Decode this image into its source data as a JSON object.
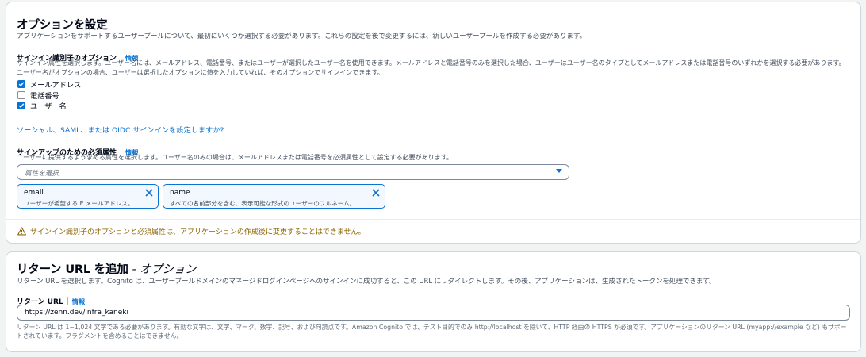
{
  "options_section": {
    "title": "オプションを設定",
    "description": "アプリケーションをサポートするユーザープールについて、最初にいくつか選択する必要があります。これらの設定を後で変更するには、新しいユーザープールを作成する必要があります。",
    "signin": {
      "label": "サインイン識別子のオプション",
      "info": "情報",
      "description_line1": "サインイン属性を選択します。ユーザー名には、メールアドレス、電話番号、またはユーザーが選択したユーザー名を使用できます。メールアドレスと電話番号のみを選択した場合、ユーザーはユーザー名のタイプとしてメールアドレスまたは電話番号のいずれかを選択する必要があります。",
      "description_line2": "ユーザー名がオプションの場合、ユーザーは選択したオプションに値を入力していれば、そのオプションでサインインできます。",
      "checkboxes": [
        {
          "label": "メールアドレス",
          "checked": true
        },
        {
          "label": "電話番号",
          "checked": false
        },
        {
          "label": "ユーザー名",
          "checked": true
        }
      ],
      "social_link": "ソーシャル、SAML、または OIDC サインインを設定しますか?"
    },
    "signup": {
      "label": "サインアップのための必須属性",
      "info": "情報",
      "description": "ユーザーに提供するよう求める属性を選択します。ユーザー名のみの場合は、メールアドレスまたは電話番号を必須属性として設定する必要があります。",
      "select_placeholder": "属性を選択",
      "tokens": [
        {
          "name": "email",
          "description": "ユーザーが希望する E メールアドレス。"
        },
        {
          "name": "name",
          "description": "すべての名前部分を含む、表示可能な形式のユーザーのフルネーム。"
        }
      ]
    },
    "warning": "サインイン識別子のオプションと必須属性は、アプリケーションの作成後に変更することはできません。"
  },
  "return_section": {
    "title": "リターン URL を追加",
    "title_suffix": "- オプション",
    "description": "リターン URL を選択します。Cognito は、ユーザープールドメインのマネージドログインページへのサインインに成功すると、この URL にリダイレクトします。その後、アプリケーションは、生成されたトークンを処理できます。",
    "field_label": "リターン URL",
    "info": "情報",
    "value": "https://zenn.dev/infra_kaneki",
    "constraint": "リターン URL は 1~1,024 文字である必要があります。有効な文字は、文字、マーク、数字、記号、および句読点です。Amazon Cognito では、テスト目的でのみ http://localhost を除いて、HTTP 経由の HTTPS が必須です。アプリケーションのリターン URL (myapp://example など) もサポートされています。フラグメントを含めることはできません。"
  },
  "colors": {
    "accent": "#0972d3",
    "warning": "#8d6605",
    "text": "#000716"
  }
}
